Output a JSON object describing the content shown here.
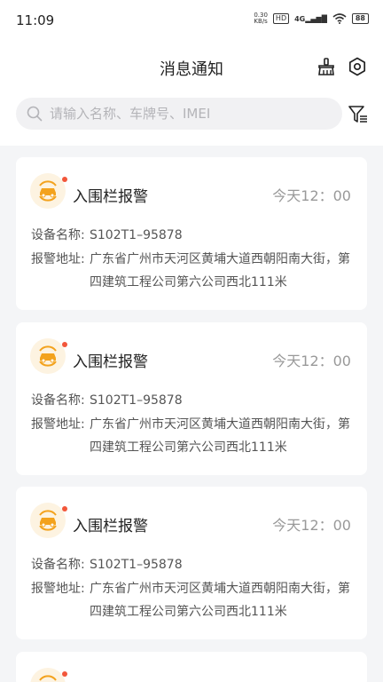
{
  "status_bar": {
    "time": "11:09",
    "net_speed_value": "0.30",
    "net_speed_unit": "KB/s",
    "hd_label": "HD",
    "network": "4G",
    "battery": "88"
  },
  "header": {
    "title": "消息通知",
    "icons": [
      "clean-broom-icon",
      "settings-gear-icon"
    ]
  },
  "search": {
    "placeholder": "请输入名称、车牌号、IMEI",
    "value": ""
  },
  "colors": {
    "accent_orange": "#f3a21d",
    "unread_dot": "#f2563a",
    "background": "#f4f5f7"
  },
  "messages": [
    {
      "title": "入围栏报警",
      "time": "今天12：00",
      "device_label": "设备名称:",
      "device_value": "S102T1–95878",
      "address_label": "报警地址:",
      "address_value": "广东省广州市天河区黄埔大道西朝阳南大街，第四建筑工程公司第六公司西北111米",
      "icon": "car-alarm-icon",
      "unread": true
    },
    {
      "title": "入围栏报警",
      "time": "今天12：00",
      "device_label": "设备名称:",
      "device_value": "S102T1–95878",
      "address_label": "报警地址:",
      "address_value": "广东省广州市天河区黄埔大道西朝阳南大街，第四建筑工程公司第六公司西北111米",
      "icon": "car-alarm-icon",
      "unread": true
    },
    {
      "title": "入围栏报警",
      "time": "今天12：00",
      "device_label": "设备名称:",
      "device_value": "S102T1–95878",
      "address_label": "报警地址:",
      "address_value": "广东省广州市天河区黄埔大道西朝阳南大街，第四建筑工程公司第六公司西北111米",
      "icon": "car-alarm-icon",
      "unread": true
    }
  ]
}
